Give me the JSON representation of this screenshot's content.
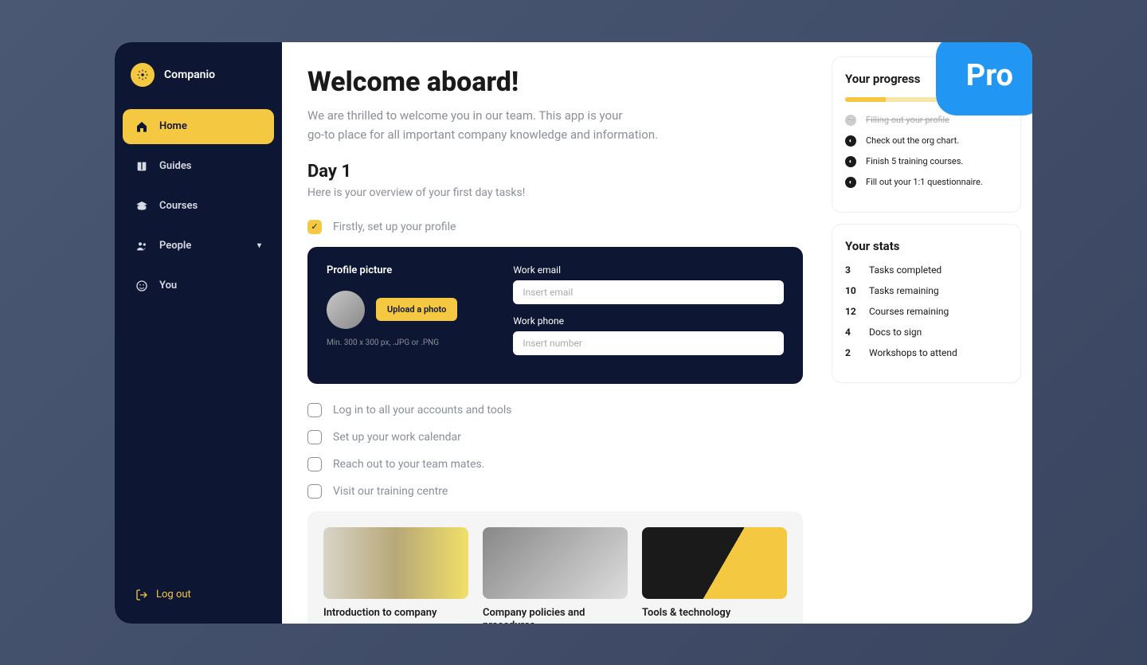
{
  "app": {
    "name": "Companio"
  },
  "nav": {
    "items": [
      {
        "label": "Home",
        "active": true
      },
      {
        "label": "Guides"
      },
      {
        "label": "Courses"
      },
      {
        "label": "People",
        "expandable": true
      },
      {
        "label": "You"
      }
    ],
    "logout": "Log out"
  },
  "header": {
    "title": "Welcome aboard!",
    "subtitle_line1": "We are thrilled to welcome you in our team. This app is your",
    "subtitle_line2": "go-to place for all important company knowledge and information."
  },
  "day": {
    "title": "Day 1",
    "subtitle": "Here is your overview of your first day tasks!"
  },
  "tasks": [
    {
      "label": "Firstly, set up your profile",
      "done": true
    },
    {
      "label": "Log in to all your accounts and tools",
      "done": false
    },
    {
      "label": "Set up your work calendar",
      "done": false
    },
    {
      "label": "Reach out to your team mates.",
      "done": false
    },
    {
      "label": "Visit our training centre",
      "done": false
    }
  ],
  "profileCard": {
    "picture_label": "Profile picture",
    "upload_label": "Upload a photo",
    "hint": "Min. 300 x 300 px, .JPG or .PNG",
    "email_label": "Work email",
    "email_placeholder": "Insert email",
    "phone_label": "Work phone",
    "phone_placeholder": "Insert number"
  },
  "courses": [
    {
      "title": "Introduction to company"
    },
    {
      "title": "Company policies and procedures"
    },
    {
      "title": "Tools & technology"
    }
  ],
  "progress": {
    "title": "Your progress",
    "percent": 25,
    "items": [
      {
        "label": "Filling out your profile",
        "done": true
      },
      {
        "label": "Check out the org chart.",
        "done": false
      },
      {
        "label": "Finish 5 training courses.",
        "done": false
      },
      {
        "label": "Fill out your 1:1 questionnaire.",
        "done": false
      }
    ]
  },
  "stats": {
    "title": "Your stats",
    "rows": [
      {
        "n": "3",
        "label": "Tasks completed"
      },
      {
        "n": "10",
        "label": "Tasks remaining"
      },
      {
        "n": "12",
        "label": "Courses remaining"
      },
      {
        "n": "4",
        "label": "Docs to sign"
      },
      {
        "n": "2",
        "label": "Workshops to attend"
      }
    ]
  },
  "badge": {
    "label": "Pro"
  }
}
